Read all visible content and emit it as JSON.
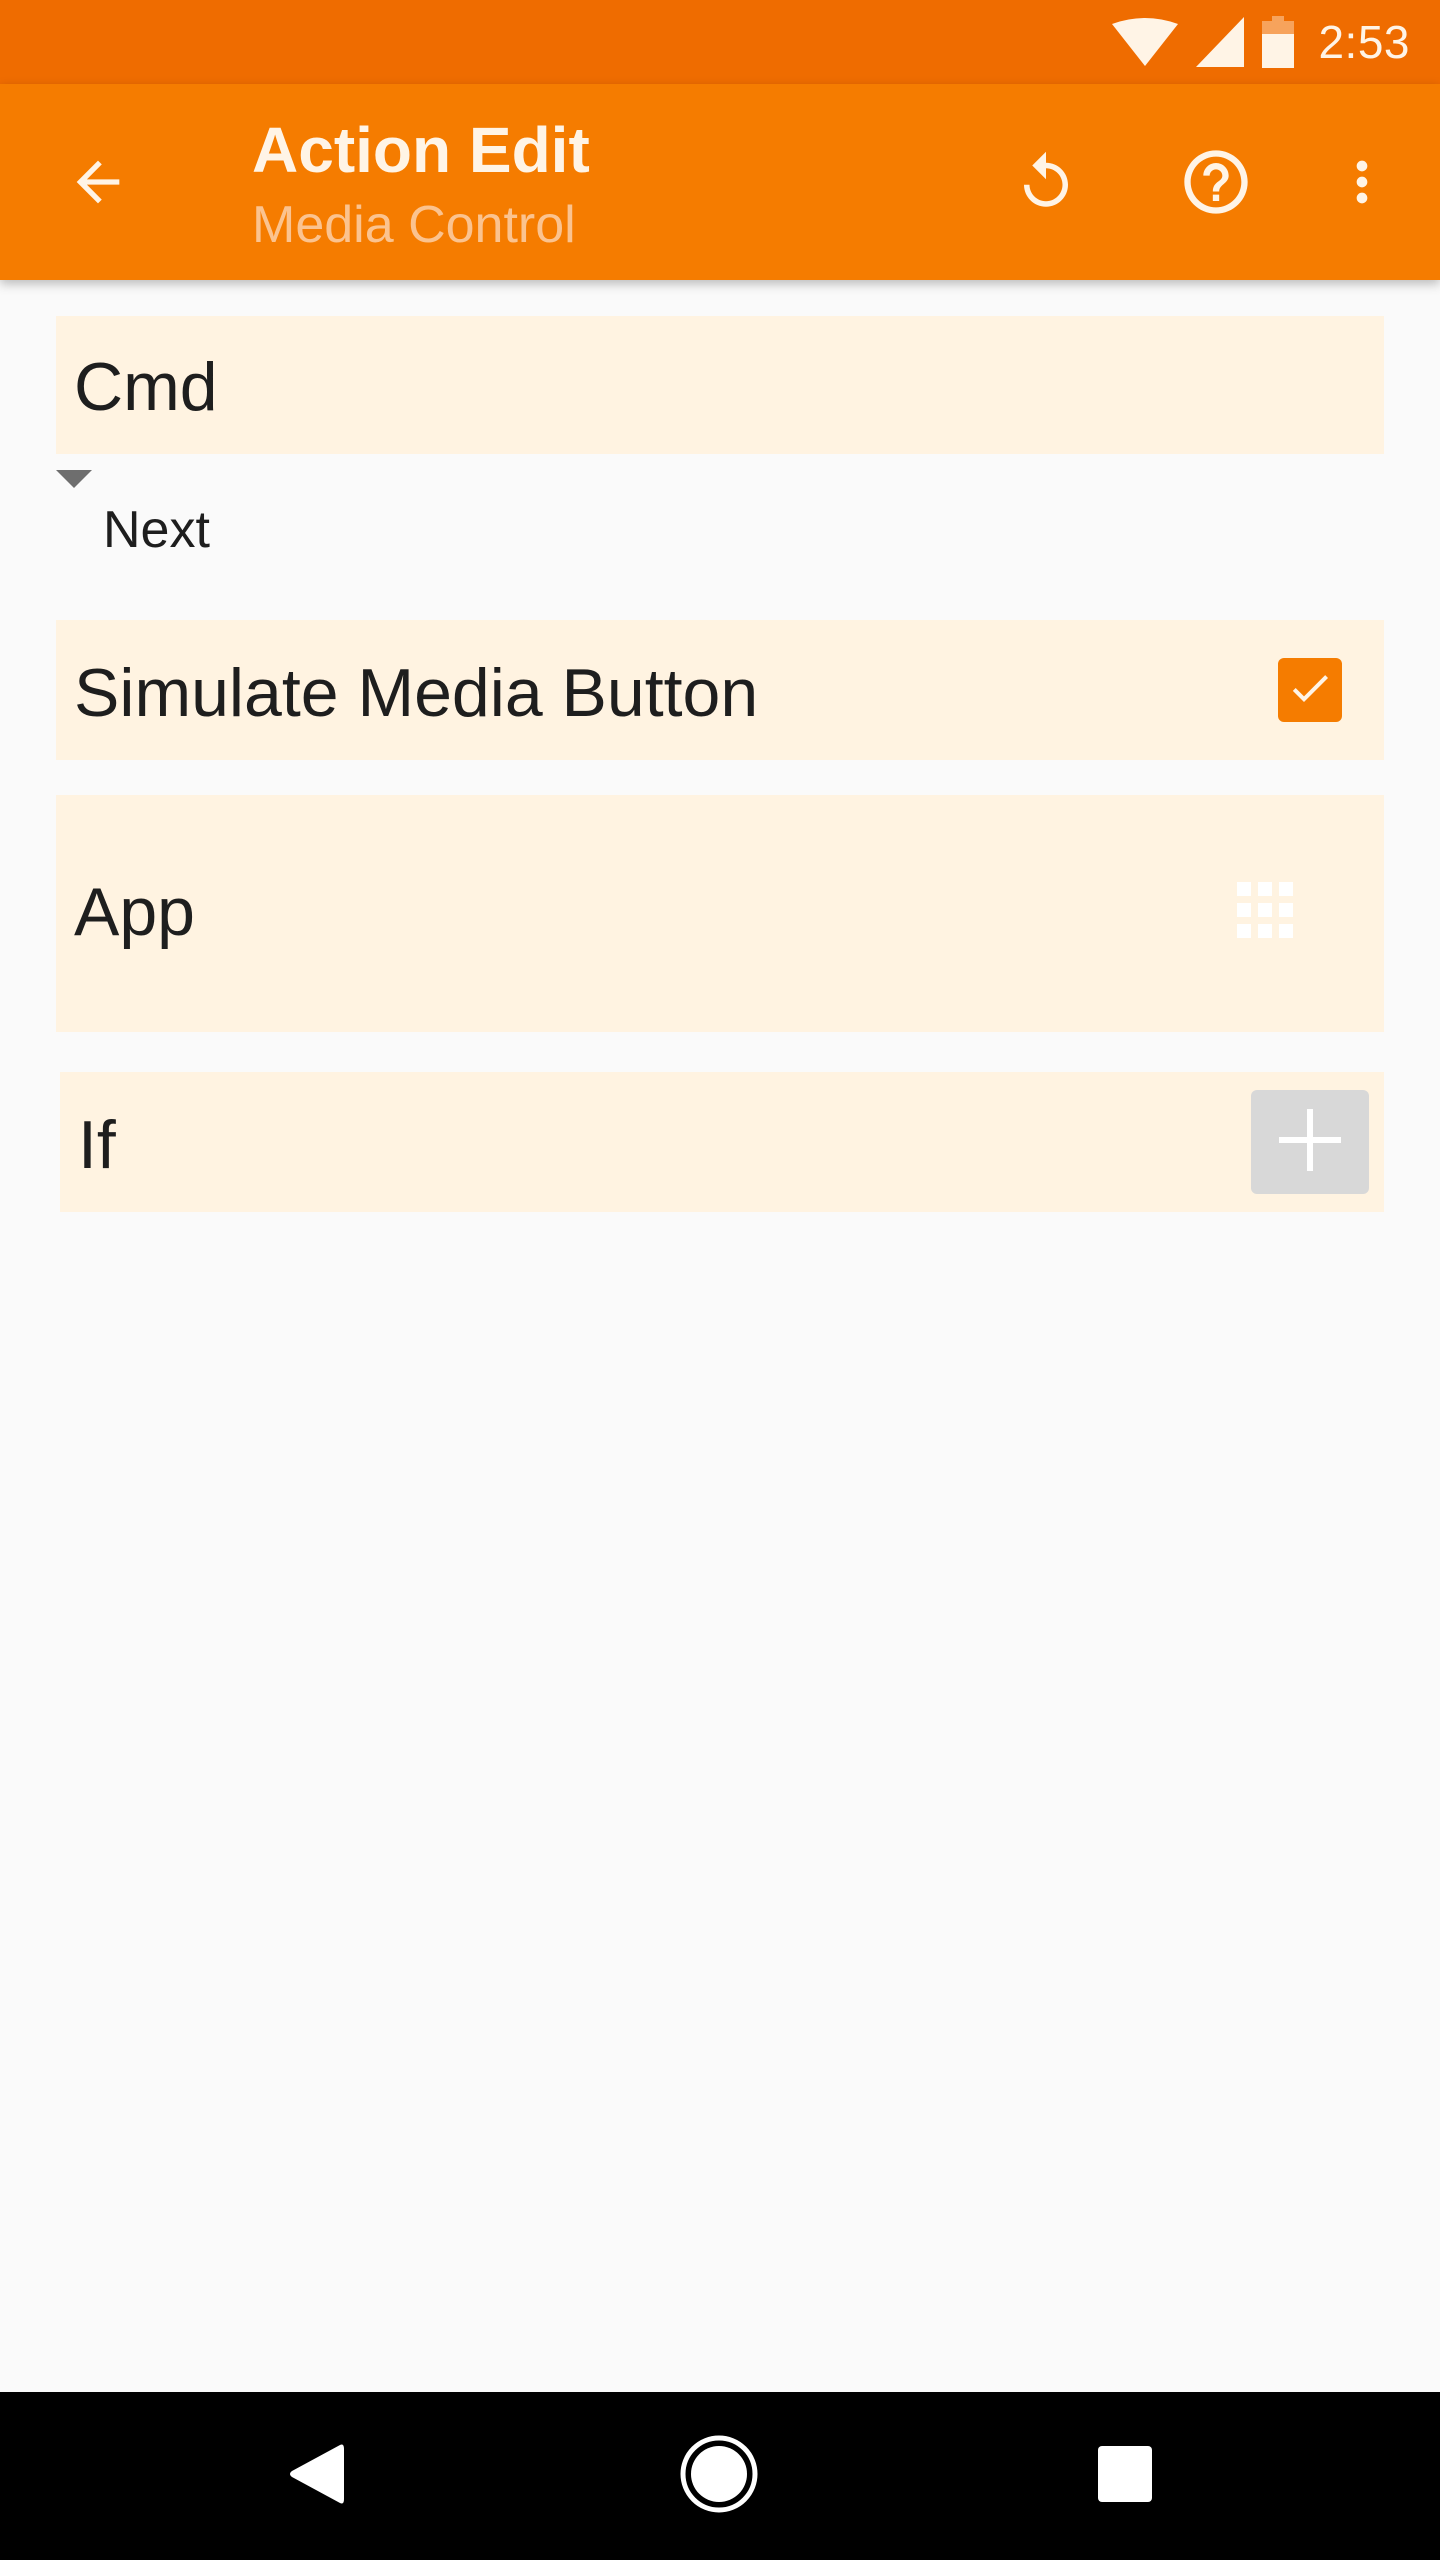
{
  "status_bar": {
    "time": "2:53",
    "icons": [
      "wifi-icon",
      "cell-signal-icon",
      "battery-icon"
    ],
    "background_color": "#ef6c00"
  },
  "app_bar": {
    "title": "Action Edit",
    "subtitle": "Media Control",
    "background_color": "#f57c00",
    "back_icon": "arrow-back-icon",
    "actions": [
      {
        "name": "reset",
        "icon": "reset-icon"
      },
      {
        "name": "help",
        "icon": "help-circle-icon"
      },
      {
        "name": "more",
        "icon": "more-vert-icon"
      }
    ]
  },
  "form": {
    "cmd": {
      "label": "Cmd",
      "selected_value": "Next"
    },
    "simulate_media_button": {
      "label": "Simulate Media Button",
      "checked": true
    },
    "app": {
      "label": "App",
      "icon": "app-grid-icon"
    },
    "if": {
      "label": "If",
      "icon": "plus-icon"
    },
    "card_color": "#fff3e1",
    "accent_color": "#f57c00"
  },
  "nav_bar": {
    "buttons": [
      "back",
      "home",
      "recents"
    ]
  }
}
